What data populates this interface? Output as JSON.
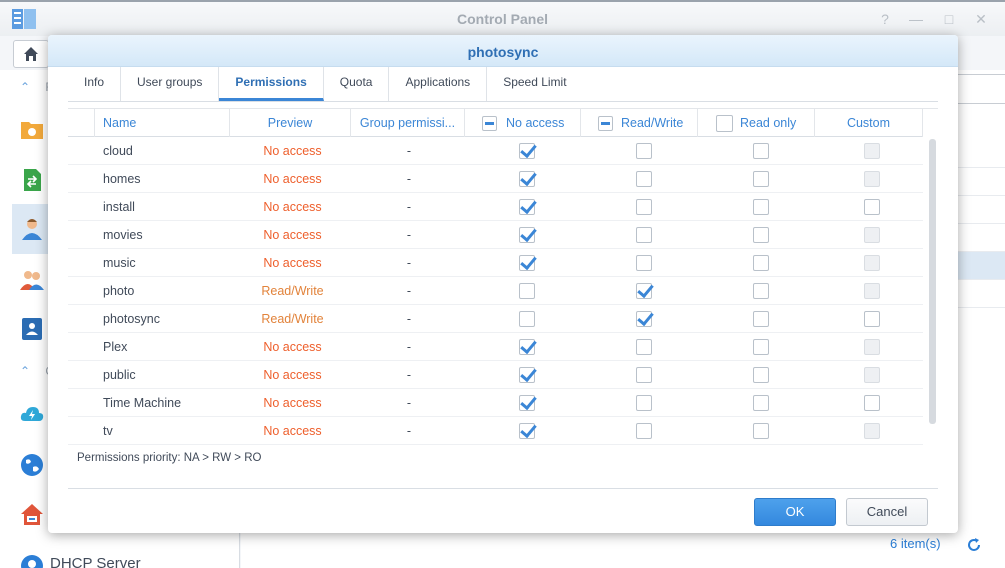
{
  "window": {
    "title": "Control Panel",
    "controls": [
      "?",
      "—",
      "□",
      "✕"
    ]
  },
  "sidebar": {
    "sections": [
      {
        "label": "F",
        "icon": "chevron-up-icon"
      },
      {
        "label": "C",
        "icon": "chevron-up-icon"
      }
    ],
    "items": [
      {
        "icon": "shared-folder-icon"
      },
      {
        "icon": "file-services-icon"
      },
      {
        "icon": "user-icon",
        "selected": true
      },
      {
        "icon": "group-icon"
      },
      {
        "icon": "domain-ldap-icon"
      },
      {
        "icon": "quickconnect-icon"
      },
      {
        "icon": "external-access-icon"
      },
      {
        "icon": "network-icon"
      }
    ],
    "dhcp_label": "DHCP Server"
  },
  "main": {
    "items_count": "6 item(s)"
  },
  "dialog": {
    "title": "photosync",
    "tabs": [
      {
        "label": "Info",
        "active": false
      },
      {
        "label": "User groups",
        "active": false
      },
      {
        "label": "Permissions",
        "active": true
      },
      {
        "label": "Quota",
        "active": false
      },
      {
        "label": "Applications",
        "active": false
      },
      {
        "label": "Speed Limit",
        "active": false
      }
    ],
    "columns": {
      "name": "Name",
      "preview": "Preview",
      "group": "Group permissi...",
      "no_access": "No access",
      "read_write": "Read/Write",
      "read_only": "Read only",
      "custom": "Custom"
    },
    "rows": [
      {
        "name": "cloud",
        "preview": "No access",
        "group": "-",
        "na": true,
        "rw": false,
        "ro": false,
        "custom_enabled": false
      },
      {
        "name": "homes",
        "preview": "No access",
        "group": "-",
        "na": true,
        "rw": false,
        "ro": false,
        "custom_enabled": false
      },
      {
        "name": "install",
        "preview": "No access",
        "group": "-",
        "na": true,
        "rw": false,
        "ro": false,
        "custom_enabled": true
      },
      {
        "name": "movies",
        "preview": "No access",
        "group": "-",
        "na": true,
        "rw": false,
        "ro": false,
        "custom_enabled": false
      },
      {
        "name": "music",
        "preview": "No access",
        "group": "-",
        "na": true,
        "rw": false,
        "ro": false,
        "custom_enabled": false
      },
      {
        "name": "photo",
        "preview": "Read/Write",
        "group": "-",
        "na": false,
        "rw": true,
        "ro": false,
        "custom_enabled": false
      },
      {
        "name": "photosync",
        "preview": "Read/Write",
        "group": "-",
        "na": false,
        "rw": true,
        "ro": false,
        "custom_enabled": true
      },
      {
        "name": "Plex",
        "preview": "No access",
        "group": "-",
        "na": true,
        "rw": false,
        "ro": false,
        "custom_enabled": false
      },
      {
        "name": "public",
        "preview": "No access",
        "group": "-",
        "na": true,
        "rw": false,
        "ro": false,
        "custom_enabled": false
      },
      {
        "name": "Time Machine",
        "preview": "No access",
        "group": "-",
        "na": true,
        "rw": false,
        "ro": false,
        "custom_enabled": true
      },
      {
        "name": "tv",
        "preview": "No access",
        "group": "-",
        "na": true,
        "rw": false,
        "ro": false,
        "custom_enabled": false
      }
    ],
    "priority_note": "Permissions priority: NA > RW > RO",
    "ok_label": "OK",
    "cancel_label": "Cancel"
  },
  "colors": {
    "accent": "#3b86d6",
    "no_access_text": "#ee5f2c",
    "read_write_text": "#e2833b",
    "dialog_title": "#2f6fb4"
  }
}
